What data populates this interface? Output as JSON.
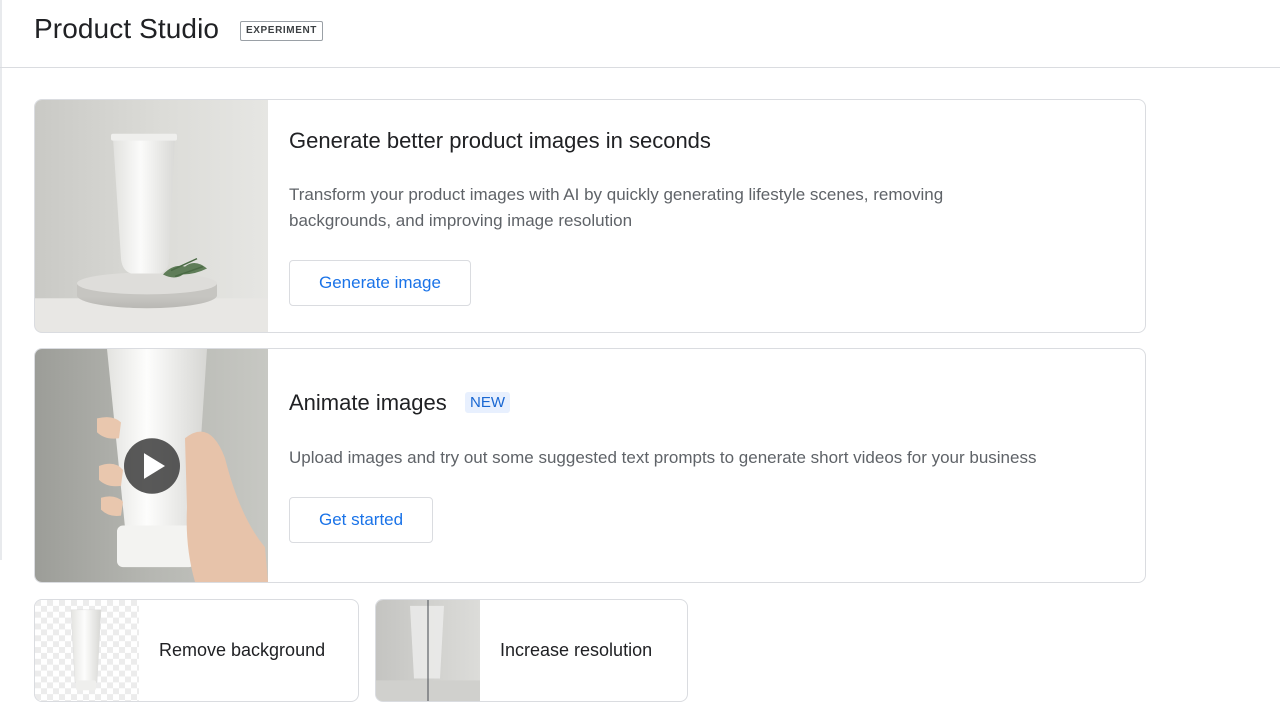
{
  "header": {
    "title": "Product Studio",
    "badge": "EXPERIMENT"
  },
  "cards": [
    {
      "heading": "Generate better product images in seconds",
      "description": "Transform your product images with AI by quickly generating lifestyle scenes, removing backgrounds, and improving image resolution",
      "button_label": "Generate image"
    },
    {
      "heading": "Animate images",
      "badge": "NEW",
      "description": "Upload images and try out some suggested text prompts to generate short videos for your business",
      "button_label": "Get started"
    }
  ],
  "tiles": [
    {
      "label": "Remove background"
    },
    {
      "label": "Increase resolution"
    }
  ],
  "colors": {
    "accent": "#1a73e8",
    "new_badge_bg": "#e8f0fe",
    "border": "#dadce0",
    "secondary_text": "#5f6368"
  },
  "icons": [
    "play-icon"
  ]
}
